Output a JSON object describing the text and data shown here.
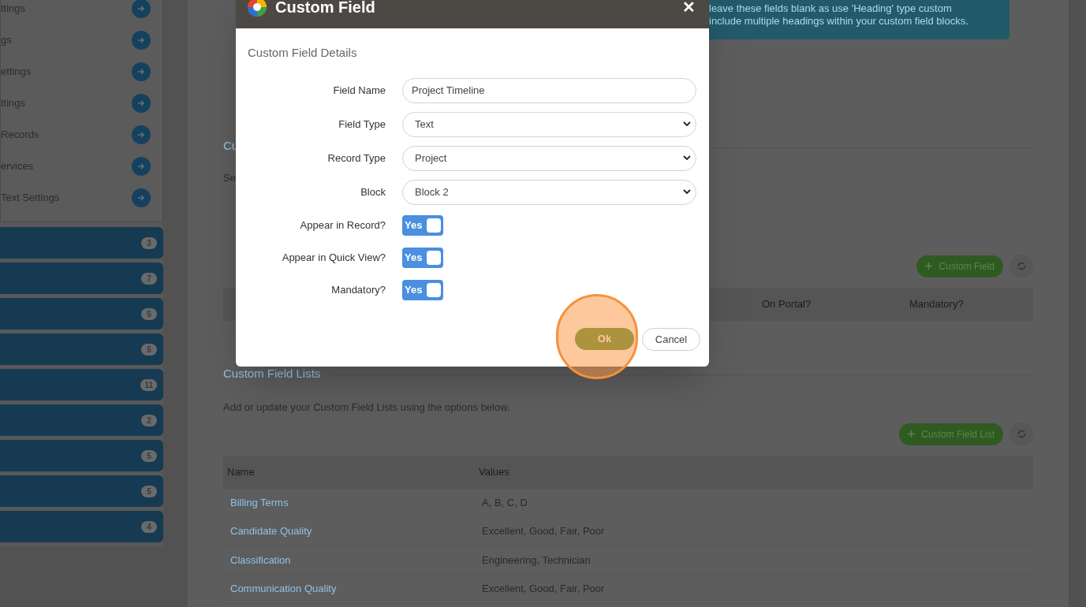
{
  "sidebar": {
    "links": [
      {
        "label": "ttings"
      },
      {
        "label": "gs"
      },
      {
        "label": "ettings"
      },
      {
        "label": "ttings"
      },
      {
        "label": "Records"
      },
      {
        "label": "ervices"
      },
      {
        "label": "Text Settings"
      }
    ],
    "groups": [
      {
        "count": "3"
      },
      {
        "count": "7"
      },
      {
        "count": "5"
      },
      {
        "count": "5"
      },
      {
        "count": "11"
      },
      {
        "count": "2"
      },
      {
        "count": "5"
      },
      {
        "count": "5"
      },
      {
        "count": "4"
      }
    ]
  },
  "banner": {
    "lines": [
      "leave these fields blank as use 'Heading' type custom",
      "include multiple headings within your custom field blocks."
    ]
  },
  "fields_section": {
    "heading": "Cu",
    "intro": "Se",
    "add_button": "Custom Field",
    "columns": [
      "On Portal?",
      "Mandatory?"
    ]
  },
  "lists_section": {
    "heading": "Custom Field Lists",
    "intro": "Add or update your Custom Field Lists using the options below.",
    "add_button": "Custom Field List",
    "columns": [
      "Name",
      "Values"
    ],
    "rows": [
      {
        "name": "Billing Terms",
        "values": "A, B, C, D"
      },
      {
        "name": "Candidate Quality",
        "values": "Excellent, Good, Fair, Poor"
      },
      {
        "name": "Classification",
        "values": "Engineering, Technician"
      },
      {
        "name": "Communication Quality",
        "values": "Excellent, Good, Fair, Poor"
      }
    ]
  },
  "dialog": {
    "title": "Custom Field",
    "close": "✕",
    "section": "Custom Field Details",
    "fields": [
      {
        "kind": "text",
        "label": "Field Name",
        "value": "Project Timeline"
      },
      {
        "kind": "select",
        "label": "Field Type",
        "value": "Text"
      },
      {
        "kind": "select",
        "label": "Record Type",
        "value": "Project"
      },
      {
        "kind": "select",
        "label": "Block",
        "value": "Block 2"
      },
      {
        "kind": "toggle",
        "label": "Appear in Record?",
        "text": "Yes",
        "on": true
      },
      {
        "kind": "toggle",
        "label": "Appear in Quick View?",
        "text": "Yes",
        "on": true
      },
      {
        "kind": "toggle",
        "label": "Mandatory?",
        "text": "Yes",
        "on": true
      }
    ],
    "buttons": [
      {
        "kind": "primary",
        "label": "Ok",
        "highlighted": true
      },
      {
        "kind": "secondary",
        "label": "Cancel",
        "highlighted": false
      }
    ]
  }
}
